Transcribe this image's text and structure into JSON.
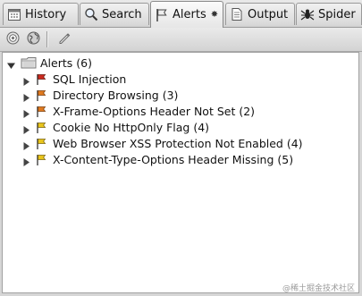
{
  "tabs": [
    {
      "label": "History",
      "icon": "calendar-icon"
    },
    {
      "label": "Search",
      "icon": "magnifier-icon"
    },
    {
      "label": "Alerts",
      "icon": "flag-icon",
      "active": true
    },
    {
      "label": "Output",
      "icon": "document-icon"
    },
    {
      "label": "Spider",
      "icon": "spider-icon"
    }
  ],
  "toolbar": {
    "buttons": [
      "target-icon",
      "globe-icon",
      "pencil-icon"
    ]
  },
  "tree": {
    "root_label": "Alerts (6)",
    "items": [
      {
        "label": "SQL Injection",
        "risk": "high"
      },
      {
        "label": "Directory Browsing (3)",
        "risk": "medium"
      },
      {
        "label": "X-Frame-Options Header Not Set (2)",
        "risk": "medium"
      },
      {
        "label": "Cookie No HttpOnly Flag (4)",
        "risk": "low"
      },
      {
        "label": "Web Browser XSS Protection Not Enabled (4)",
        "risk": "low"
      },
      {
        "label": "X-Content-Type-Options Header Missing (5)",
        "risk": "low"
      }
    ]
  },
  "watermark": "@稀土掘金技术社区",
  "colors": {
    "high": "#cc2a1e",
    "medium": "#e07a1f",
    "low": "#e9c51b"
  }
}
